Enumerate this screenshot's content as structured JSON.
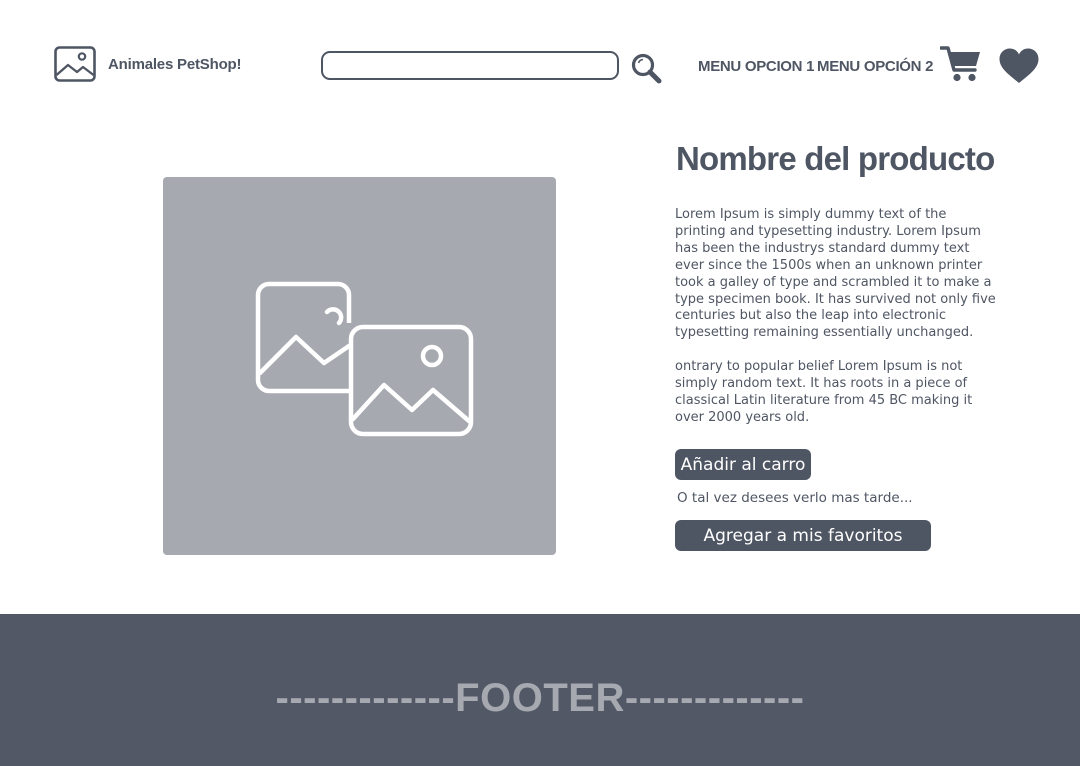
{
  "header": {
    "brand": "Animales PetShop!",
    "search": {
      "value": "",
      "placeholder": ""
    },
    "menu": [
      "MENU OPCION 1",
      "MENU OPCIÓN 2"
    ]
  },
  "product": {
    "title": "Nombre del producto",
    "description": [
      "Lorem Ipsum is simply dummy text of the printing and typesetting industry. Lorem Ipsum has been the industrys standard dummy text ever since the 1500s when an unknown printer took a galley of type and scrambled it to make a type specimen book. It has survived not only five centuries but also the leap into electronic typesetting remaining essentially unchanged.",
      "ontrary to popular belief Lorem Ipsum is not simply random text. It has roots in a piece of classical Latin literature from 45 BC making it over 2000 years old."
    ],
    "add_to_cart_label": "Añadir al carro",
    "later_text": "O tal vez desees verlo mas tarde...",
    "add_to_favorites_label": "Agregar a mis favoritos"
  },
  "footer": {
    "text": "-------------FOOTER-------------"
  },
  "icons": {
    "logo": "image-icon",
    "search": "search-icon",
    "cart": "cart-icon",
    "favorites": "heart-icon",
    "product_placeholder": "images-icon"
  },
  "colors": {
    "primary": "#4f5663",
    "placeholder_bg": "#a6a9b0",
    "footer_bg": "#525866",
    "footer_text": "#a6a9b0"
  }
}
